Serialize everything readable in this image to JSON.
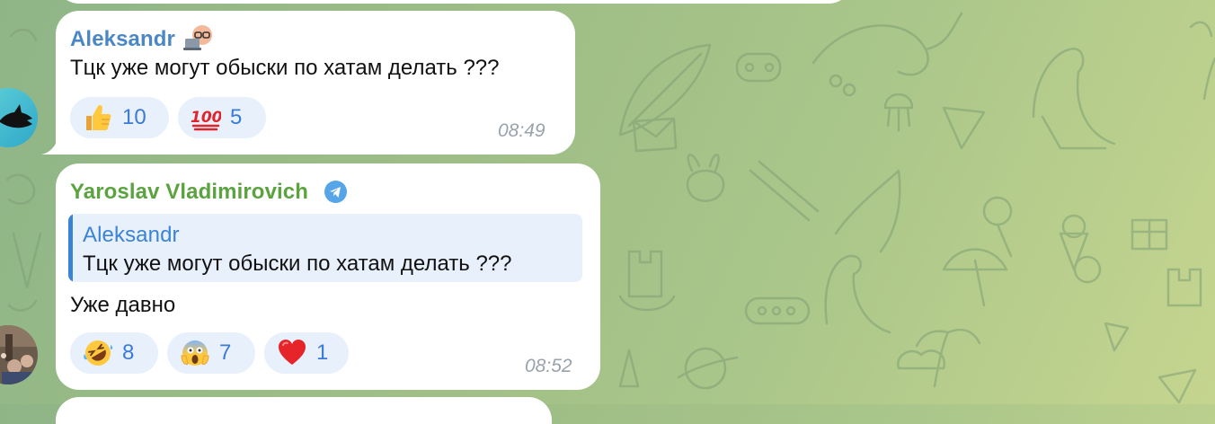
{
  "messages": [
    {
      "sender": "Aleksandr",
      "sender_color": "#4a87c4",
      "text": "Тцк уже могут обыски по хатам делать ???",
      "time": "08:49",
      "reactions": [
        {
          "emoji": "thumbs-up",
          "count": "10"
        },
        {
          "emoji": "hundred-points",
          "count": "5"
        }
      ]
    },
    {
      "sender": "Yaroslav Vladimirovich",
      "sender_color": "#5aa33f",
      "reply": {
        "sender": "Aleksandr",
        "text": "Тцк уже могут обыски по хатам делать ???"
      },
      "text": "Уже давно",
      "time": "08:52",
      "reactions": [
        {
          "emoji": "rolling-on-floor-laughing",
          "count": "8"
        },
        {
          "emoji": "face-screaming-in-fear",
          "count": "7"
        },
        {
          "emoji": "red-heart",
          "count": "1"
        }
      ]
    }
  ],
  "colors": {
    "accent": "#3a7bd5",
    "reaction_bg": "#e8f0fb",
    "time": "#9aa3ab",
    "wallpaper": "#a3c189"
  }
}
